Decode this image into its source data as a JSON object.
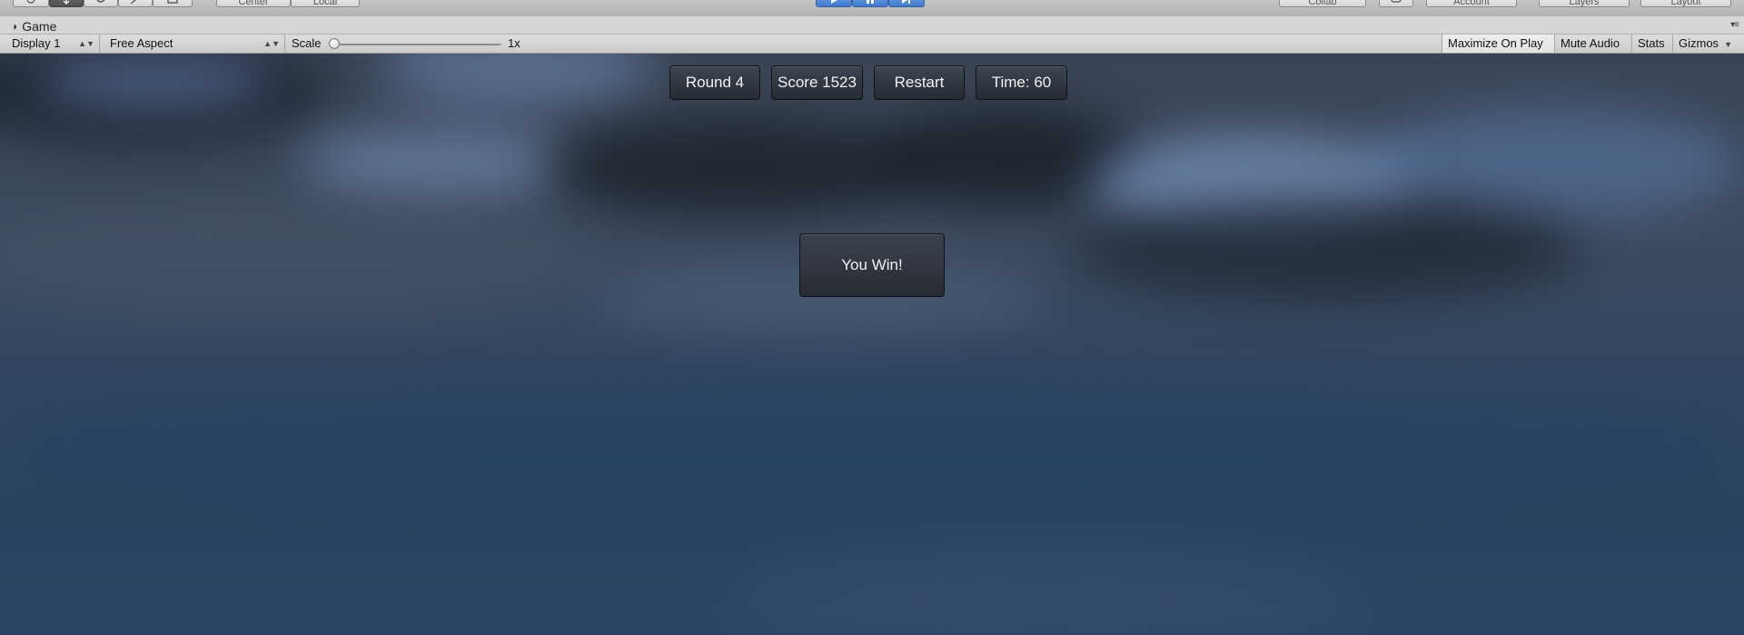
{
  "toolbar": {
    "pivot_label": "Center",
    "space_label": "Local",
    "collab_label": "Collab",
    "account_label": "Account",
    "layers_label": "Layers",
    "layout_label": "Layout"
  },
  "game_tab": {
    "title": "Game"
  },
  "game_controls": {
    "display": "Display 1",
    "aspect": "Free Aspect",
    "scale_label": "Scale",
    "scale_value": "1x",
    "scale_level": 0.0,
    "maximize_on_play": "Maximize On Play",
    "mute_audio": "Mute Audio",
    "stats": "Stats",
    "gizmos": "Gizmos"
  },
  "hud": {
    "round": "Round 4",
    "score": "Score 1523",
    "restart": "Restart",
    "time": "Time: 60"
  },
  "message": {
    "text": "You Win!"
  },
  "colors": {
    "play_accent": "#3f78c9",
    "hud_button": "#2e343f",
    "sky_dark": "#2a3a52"
  }
}
